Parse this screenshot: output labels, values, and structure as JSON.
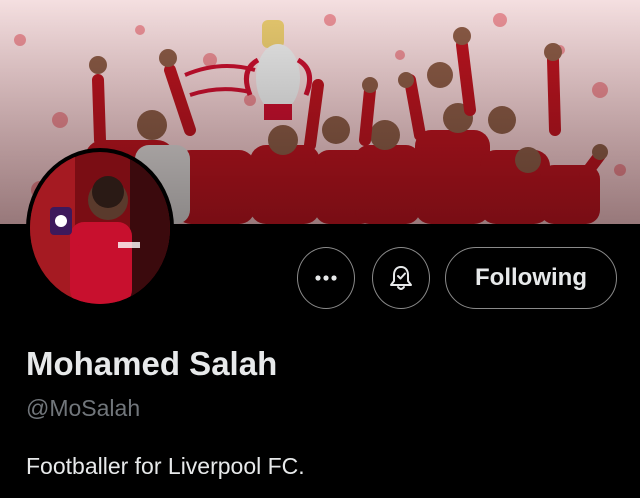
{
  "profile": {
    "display_name": "Mohamed Salah",
    "handle": "@MoSalah",
    "bio": "Footballer for Liverpool FC."
  },
  "actions": {
    "following_label": "Following",
    "more_icon": "more-options-icon",
    "notify_icon": "bell-notification-icon"
  },
  "colors": {
    "background": "#000000",
    "text_primary": "#e7e9ea",
    "text_secondary": "#71767b",
    "button_border": "#8a8a8a",
    "banner_red": "#c8102e"
  }
}
